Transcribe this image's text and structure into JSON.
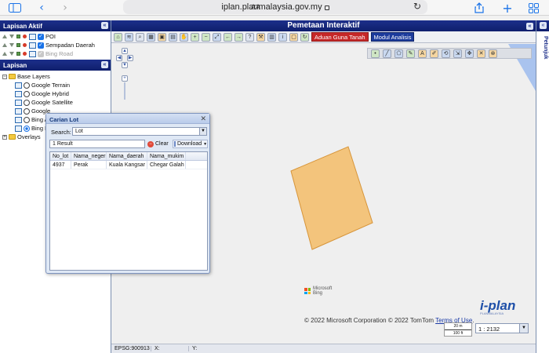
{
  "browser": {
    "aa_label": "AA",
    "url": "iplan.planmalaysia.gov.my",
    "icons": [
      "sidebar-icon",
      "back-icon",
      "forward-icon",
      "reload-icon",
      "share-icon",
      "new-tab-icon",
      "tabs-icon"
    ]
  },
  "left_panel": {
    "active_layers_title": "Lapisan Aktif",
    "active_layers": [
      {
        "label": "POI",
        "checked": true
      },
      {
        "label": "Sempadan Daerah",
        "checked": true
      },
      {
        "label": "Bing Road",
        "checked": false
      }
    ],
    "layers_title": "Lapisan",
    "tree": {
      "base_layers_label": "Base Layers",
      "base_layers": [
        {
          "label": "Google Terrain",
          "selected": false
        },
        {
          "label": "Google Hybrid",
          "selected": false
        },
        {
          "label": "Google Satellite",
          "selected": false
        },
        {
          "label": "Google",
          "selected": false
        },
        {
          "label": "Bing A",
          "selected": false
        },
        {
          "label": "Bing R",
          "selected": true
        }
      ],
      "overlays_label": "Overlays"
    }
  },
  "header": {
    "title": "Pemetaan Interaktif",
    "aduan_button": "Aduan Guna Tanah",
    "modul_button": "Modul Analisis"
  },
  "right_panel": {
    "label": "Petunjuk"
  },
  "map": {
    "bing_label_1": "Microsoft",
    "bing_label_2": "Bing",
    "copyright": "© 2022 Microsoft Corporation © 2022 TomTom ",
    "terms_link": "Terms of Use",
    "logo_text": "i-plan",
    "scale_m": "20 m",
    "scale_ft": "100 ft",
    "scale_value": "1 : 2132",
    "lot_fill": "#f3c47c",
    "lot_stroke": "#d7953a"
  },
  "status": {
    "epsg": "EPSG:900913",
    "x_label": "X:",
    "y_label": "Y:"
  },
  "dialog": {
    "title": "Carian Lot",
    "search_label": "Search:",
    "search_value": "Lot",
    "result_count": "1 Result",
    "clear_label": "Clear",
    "download_label": "Download",
    "columns": [
      "No_lot",
      "Nama_negeri",
      "Nama_daerah",
      "Nama_mukim"
    ],
    "rows": [
      [
        "4937",
        "Perak",
        "Kuala Kangsar",
        "Chegar Galah"
      ]
    ]
  }
}
